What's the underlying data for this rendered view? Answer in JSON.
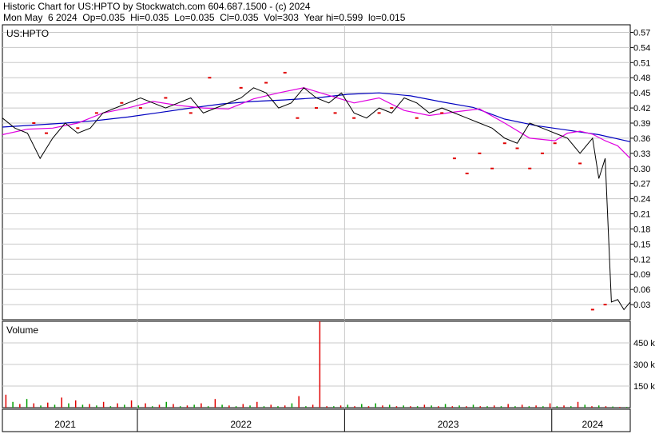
{
  "header": {
    "line1": "Historic Chart for US:HPTO by Stockwatch.com 604.687.1500 - (c) 2024",
    "line2": "Mon May  6 2024  Op=0.035  Hi=0.035  Lo=0.035  Cl=0.035  Vol=303  Year hi=0.599  lo=0.015"
  },
  "chart_data": [
    {
      "type": "line",
      "title": "US:HPTO",
      "price_ticks": [
        "0.57",
        "0.54",
        "0.51",
        "0.48",
        "0.45",
        "0.42",
        "0.39",
        "0.36",
        "0.33",
        "0.30",
        "0.27",
        "0.24",
        "0.21",
        "0.18",
        "0.15",
        "0.12",
        "0.09",
        "0.06",
        "0.03"
      ],
      "ylim": [
        0.0,
        0.585
      ],
      "x_labels": [
        "2021",
        "2022",
        "2023",
        "2024"
      ],
      "grid": true,
      "series": [
        {
          "name": "",
          "color": "#0000c0",
          "role": "long moving average",
          "x": [
            0,
            0.05,
            0.1,
            0.15,
            0.2,
            0.25,
            0.3,
            0.35,
            0.4,
            0.45,
            0.5,
            0.55,
            0.6,
            0.65,
            0.7,
            0.75,
            0.8,
            0.85,
            0.9,
            0.95,
            1
          ],
          "values": [
            0.382,
            0.386,
            0.39,
            0.395,
            0.402,
            0.411,
            0.42,
            0.428,
            0.433,
            0.436,
            0.44,
            0.447,
            0.45,
            0.444,
            0.432,
            0.421,
            0.398,
            0.385,
            0.376,
            0.367,
            0.353
          ]
        },
        {
          "name": "",
          "color": "#e000e0",
          "role": "short moving average",
          "x": [
            0,
            0.04,
            0.08,
            0.12,
            0.16,
            0.2,
            0.24,
            0.28,
            0.32,
            0.36,
            0.4,
            0.44,
            0.48,
            0.52,
            0.56,
            0.6,
            0.64,
            0.68,
            0.72,
            0.76,
            0.8,
            0.84,
            0.88,
            0.9,
            0.92,
            0.94,
            0.96,
            0.98,
            1
          ],
          "values": [
            0.367,
            0.378,
            0.38,
            0.39,
            0.41,
            0.42,
            0.433,
            0.425,
            0.42,
            0.418,
            0.438,
            0.45,
            0.46,
            0.445,
            0.43,
            0.44,
            0.415,
            0.405,
            0.412,
            0.418,
            0.39,
            0.36,
            0.355,
            0.37,
            0.374,
            0.368,
            0.355,
            0.345,
            0.32
          ]
        }
      ],
      "price_path": {
        "color": "#000000",
        "x": [
          0,
          0.02,
          0.04,
          0.06,
          0.08,
          0.1,
          0.12,
          0.14,
          0.16,
          0.18,
          0.2,
          0.22,
          0.24,
          0.26,
          0.28,
          0.3,
          0.32,
          0.34,
          0.36,
          0.38,
          0.4,
          0.42,
          0.44,
          0.46,
          0.48,
          0.5,
          0.52,
          0.54,
          0.56,
          0.58,
          0.6,
          0.62,
          0.64,
          0.66,
          0.68,
          0.7,
          0.72,
          0.74,
          0.76,
          0.78,
          0.8,
          0.82,
          0.84,
          0.86,
          0.88,
          0.9,
          0.92,
          0.94,
          0.95,
          0.96,
          0.97,
          0.98,
          0.99,
          1
        ],
        "values": [
          0.4,
          0.38,
          0.37,
          0.32,
          0.36,
          0.39,
          0.37,
          0.38,
          0.41,
          0.42,
          0.43,
          0.44,
          0.43,
          0.42,
          0.43,
          0.44,
          0.41,
          0.42,
          0.43,
          0.44,
          0.46,
          0.45,
          0.42,
          0.43,
          0.46,
          0.44,
          0.43,
          0.45,
          0.41,
          0.4,
          0.42,
          0.41,
          0.44,
          0.43,
          0.41,
          0.42,
          0.41,
          0.4,
          0.39,
          0.38,
          0.36,
          0.35,
          0.39,
          0.38,
          0.37,
          0.36,
          0.33,
          0.36,
          0.28,
          0.32,
          0.035,
          0.04,
          0.02,
          0.035
        ]
      },
      "red_marks": {
        "x": [
          0.05,
          0.07,
          0.12,
          0.15,
          0.19,
          0.22,
          0.26,
          0.3,
          0.33,
          0.38,
          0.42,
          0.45,
          0.47,
          0.5,
          0.53,
          0.56,
          0.6,
          0.62,
          0.66,
          0.7,
          0.72,
          0.74,
          0.76,
          0.78,
          0.8,
          0.82,
          0.84,
          0.86,
          0.88,
          0.92,
          0.94,
          0.96
        ],
        "values": [
          0.39,
          0.37,
          0.38,
          0.41,
          0.43,
          0.42,
          0.44,
          0.41,
          0.48,
          0.46,
          0.47,
          0.49,
          0.4,
          0.42,
          0.41,
          0.4,
          0.41,
          0.42,
          0.4,
          0.41,
          0.32,
          0.29,
          0.33,
          0.3,
          0.35,
          0.34,
          0.3,
          0.33,
          0.35,
          0.31,
          0.02,
          0.03
        ]
      }
    },
    {
      "type": "bar",
      "title": "Volume",
      "volume_ticks": [
        "450 k",
        "300 k",
        "150 k"
      ],
      "ylim": [
        0,
        600
      ],
      "x_labels": [
        "2021",
        "2022",
        "2023",
        "2024"
      ],
      "values": [
        90,
        40,
        25,
        60,
        30,
        15,
        35,
        20,
        70,
        30,
        50,
        20,
        25,
        15,
        40,
        10,
        30,
        20,
        50,
        15,
        30,
        10,
        20,
        40,
        25,
        10,
        15,
        20,
        30,
        10,
        60,
        20,
        15,
        10,
        25,
        15,
        40,
        10,
        20,
        10,
        15,
        30,
        80,
        10,
        20,
        600,
        10,
        10,
        15,
        20,
        10,
        25,
        10,
        30,
        15,
        20,
        10,
        15,
        10,
        10,
        20,
        15,
        10,
        25,
        10,
        15,
        10,
        20,
        10,
        10,
        15,
        10,
        25,
        10,
        20,
        10,
        15,
        10,
        30,
        10,
        15,
        10,
        40,
        20,
        10,
        15,
        10,
        8,
        5,
        5
      ],
      "colors": [
        "#e00000",
        "#00a000",
        "#e00000",
        "#00a000",
        "#e00000",
        "#00a000",
        "#e00000",
        "#00a000",
        "#e00000",
        "#00a000"
      ]
    }
  ]
}
